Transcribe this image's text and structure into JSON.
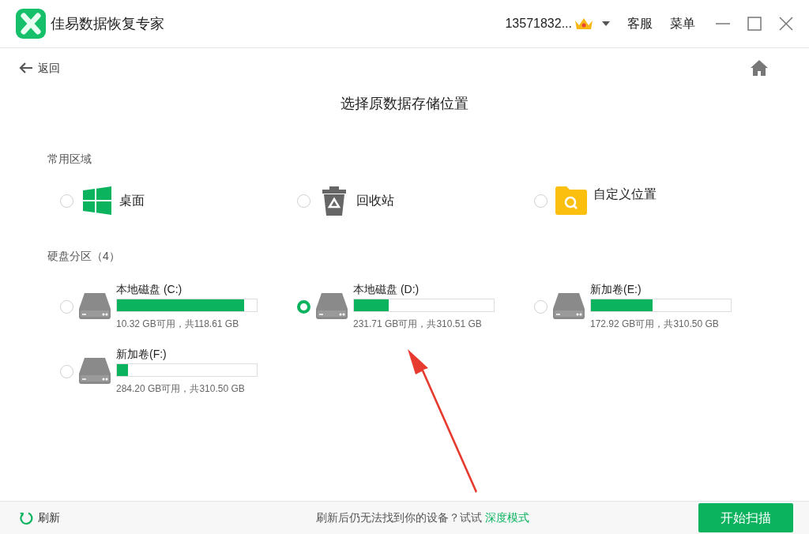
{
  "window": {
    "title": "佳易数据恢复专家",
    "account": "13571832...",
    "buttons": [
      "客服",
      "菜单"
    ]
  },
  "nav": {
    "back": "返回"
  },
  "heading": "选择原数据存储位置",
  "common": {
    "label": "常用区域",
    "items": [
      {
        "kind": "desktop",
        "label": "桌面",
        "selected": false
      },
      {
        "kind": "recycle",
        "label": "回收站",
        "selected": false
      },
      {
        "kind": "custom",
        "label": "自定义位置",
        "selected": false
      }
    ]
  },
  "disks": {
    "label": "硬盘分区（4）",
    "items": [
      {
        "name": "本地磁盘 (C:)",
        "level": 0.91,
        "info": "10.32 GB可用，共118.61 GB",
        "selected": false
      },
      {
        "name": "本地磁盘 (D:)",
        "level": 0.25,
        "info": "231.71 GB可用，共310.51 GB",
        "selected": true
      },
      {
        "name": "新加卷(E:)",
        "level": 0.44,
        "info": "172.92 GB可用，共310.50 GB",
        "selected": false
      },
      {
        "name": "新加卷(F:)",
        "level": 0.08,
        "info": "284.20 GB可用，共310.50 GB",
        "selected": false
      }
    ]
  },
  "footer": {
    "refresh": "刷新",
    "hint": "刷新后仍无法找到你的设备？试试",
    "link": "深度模式",
    "start": "开始扫描"
  }
}
